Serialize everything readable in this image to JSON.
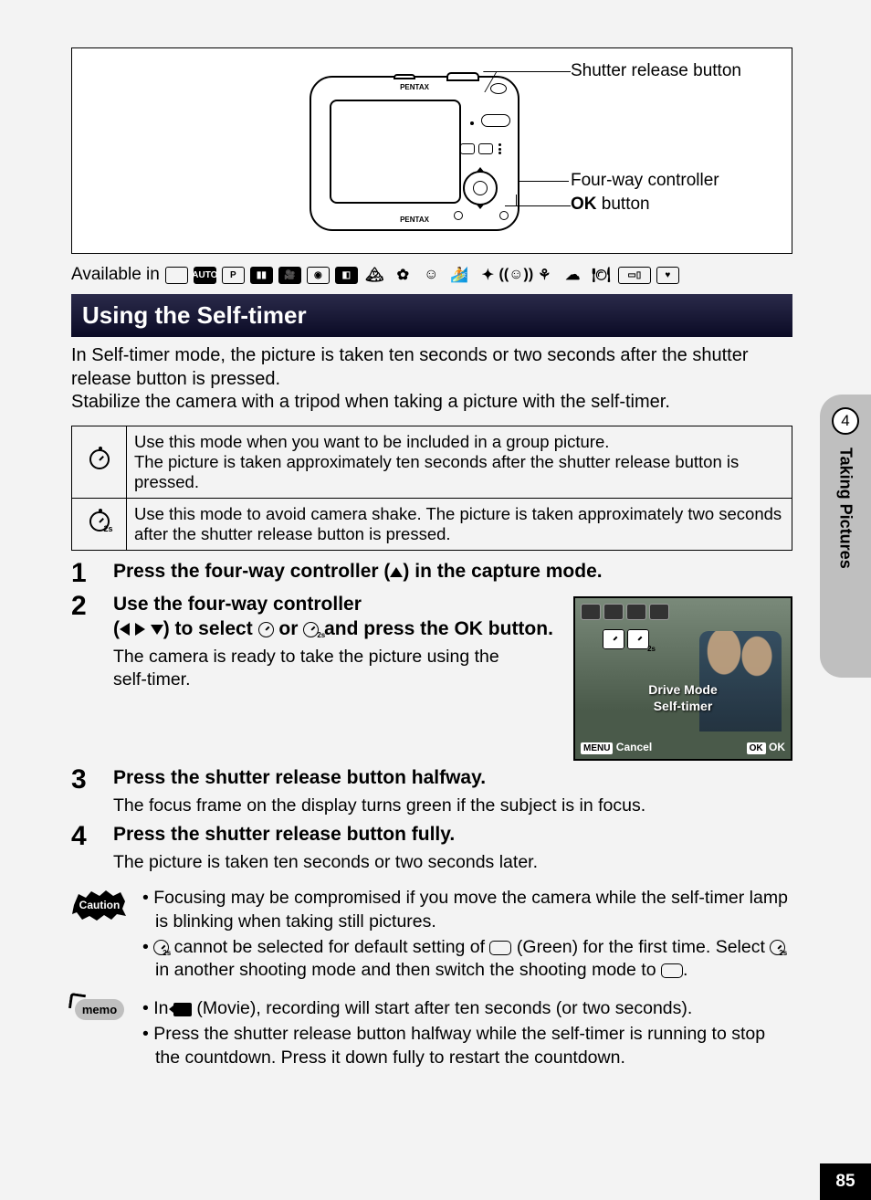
{
  "callouts": {
    "shutter": "Shutter release button",
    "fourway": "Four-way controller",
    "ok_bold": "OK",
    "ok_rest": " button"
  },
  "camera_brand": "PENTAX",
  "available_label": "Available in",
  "heading": "Using the Self-timer",
  "intro": "In Self-timer mode, the picture is taken ten seconds or two seconds after the shutter release button is pressed.\nStabilize the camera with a tripod when taking a picture with the self-timer.",
  "table": {
    "r1": "Use this mode when you want to be included in a group picture.\nThe picture is taken approximately ten seconds after the shutter release button is pressed.",
    "r2": "Use this mode to avoid camera shake. The picture is taken approximately two seconds after the shutter release button is pressed."
  },
  "steps": [
    {
      "num": "1",
      "title_a": "Press the four-way controller (",
      "title_b": ") in the capture mode."
    },
    {
      "num": "2",
      "title": "Use the four-way controller",
      "line2a": "(",
      "line2b": ") to select ",
      "line2c": " or ",
      "line2d": " and press the ",
      "line2e": " button.",
      "desc": "The camera is ready to take the picture using the self-timer."
    },
    {
      "num": "3",
      "title": "Press the shutter release button halfway.",
      "desc": "The focus frame on the display turns green if the subject is in focus."
    },
    {
      "num": "4",
      "title": "Press the shutter release button fully.",
      "desc": "The picture is taken ten seconds or two seconds later."
    }
  ],
  "ok_label": "OK",
  "screen": {
    "drive_mode": "Drive Mode",
    "self_timer": "Self-timer",
    "menu": "MENU",
    "cancel": "Cancel",
    "ok1": "OK",
    "ok2": "OK"
  },
  "caution": {
    "b1": "Focusing may be compromised if you move the camera while the self-timer lamp is blinking when taking still pictures.",
    "b2a": " cannot be selected for default setting of ",
    "b2b": " (Green) for the first time. Select ",
    "b2c": " in another shooting mode and then switch the shooting mode to ",
    "b2d": "."
  },
  "memo": {
    "label": "memo",
    "b1a": "In ",
    "b1b": " (Movie), recording will start after ten seconds (or two seconds).",
    "b2": "Press the shutter release button halfway while the self-timer is running to stop the countdown. Press it down fully to restart the countdown."
  },
  "sidebar": {
    "chapter": "4",
    "title": "Taking Pictures"
  },
  "page_number": "85"
}
